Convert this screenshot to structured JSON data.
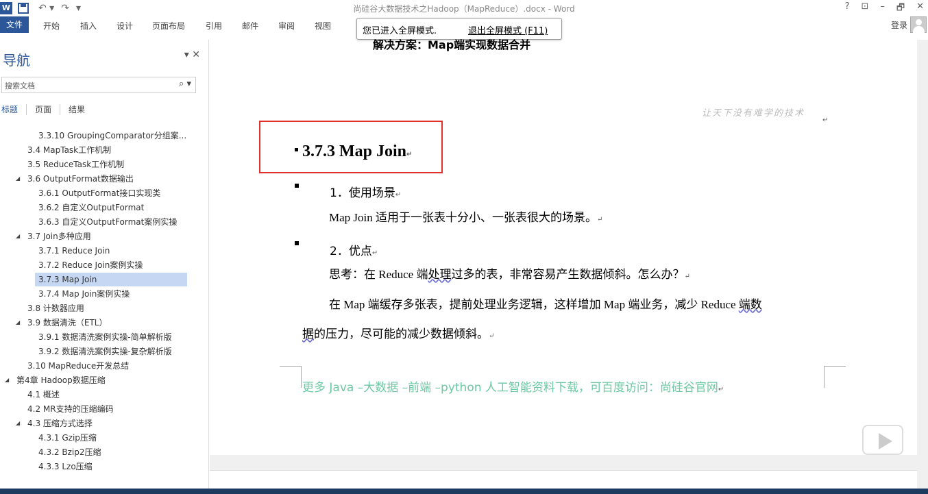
{
  "window": {
    "title": "尚硅谷大数据技术之Hadoop（MapReduce）.docx - Word",
    "controls": [
      "?",
      "⊡",
      "–",
      "🗗",
      "✕"
    ]
  },
  "qat": {
    "undo": "↶ ▾",
    "redo": "↷",
    "more": "▾",
    "logo": "W"
  },
  "ribbon_tabs": [
    "文件",
    "开始",
    "插入",
    "设计",
    "页面布局",
    "引用",
    "邮件",
    "审阅",
    "视图"
  ],
  "account": {
    "login": "登录"
  },
  "fullscreen_banner": {
    "message": "您已进入全屏模式.",
    "exit_link": "退出全屏模式 (F11)"
  },
  "nav_pane": {
    "title": "导航",
    "controls": "▾ ✕",
    "search_placeholder": "搜索文档",
    "search_icon": "⌕ ▾",
    "tabs": [
      "标题",
      "页面",
      "结果"
    ],
    "items": [
      {
        "text": "3.3.10 GroupingComparator分组案...",
        "level": 2
      },
      {
        "text": "3.4 MapTask工作机制",
        "level": 1
      },
      {
        "text": "3.5 ReduceTask工作机制",
        "level": 1
      },
      {
        "text": "3.6 OutputFormat数据输出",
        "level": 1,
        "expanded": true
      },
      {
        "text": "3.6.1 OutputFormat接口实现类",
        "level": 2
      },
      {
        "text": "3.6.2 自定义OutputFormat",
        "level": 2
      },
      {
        "text": "3.6.3 自定义OutputFormat案例实操",
        "level": 2
      },
      {
        "text": "3.7 Join多种应用",
        "level": 1,
        "expanded": true
      },
      {
        "text": "3.7.1 Reduce Join",
        "level": 2
      },
      {
        "text": "3.7.2 Reduce Join案例实操",
        "level": 2
      },
      {
        "text": "3.7.3 Map Join",
        "level": 2,
        "selected": true
      },
      {
        "text": "3.7.4 Map Join案例实操",
        "level": 2
      },
      {
        "text": "3.8 计数器应用",
        "level": 1
      },
      {
        "text": "3.9 数据清洗（ETL）",
        "level": 1,
        "expanded": true
      },
      {
        "text": "3.9.1 数据清洗案例实操-简单解析版",
        "level": 2
      },
      {
        "text": "3.9.2 数据清洗案例实操-复杂解析版",
        "level": 2
      },
      {
        "text": "3.10 MapReduce开发总结",
        "level": 1
      },
      {
        "text": "第4章 Hadoop数据压缩",
        "level": 0,
        "expanded": true
      },
      {
        "text": "4.1 概述",
        "level": 1
      },
      {
        "text": "4.2 MR支持的压缩编码",
        "level": 1
      },
      {
        "text": "4.3 压缩方式选择",
        "level": 1,
        "expanded": true
      },
      {
        "text": "4.3.1 Gzip压缩",
        "level": 2
      },
      {
        "text": "4.3.2 Bzip2压缩",
        "level": 2
      },
      {
        "text": "4.3.3 Lzo压缩",
        "level": 2
      }
    ]
  },
  "document": {
    "top_cut_line": "解决方案：Map端实现数据合并",
    "watermark": "让天下没有难学的技术",
    "heading": "3.7.3 Map Join",
    "section1_title": "1．使用场景",
    "section1_body": "Map Join 适用于一张表十分小、一张表很大的场景。",
    "section2_title": "2．优点",
    "section2_line1_a": "思考：在 Reduce 端",
    "section2_line1_sq": "处理",
    "section2_line1_b": "过多的表，非常容易产生数据倾斜。怎么办？",
    "section2_line2_a": "在 Map 端缓存多张表，提前处理业务逻辑，这样增加 Map 端业务，减少 Reduce ",
    "section2_line2_sq": "端数",
    "section2_line3_sq": "据",
    "section2_line3_b": "的压力，尽可能的减少数据倾斜。",
    "footer": "更多 Java –大数据 –前端 –python 人工智能资料下载，可百度访问：尚硅谷官网",
    "para_mark": "↵"
  }
}
